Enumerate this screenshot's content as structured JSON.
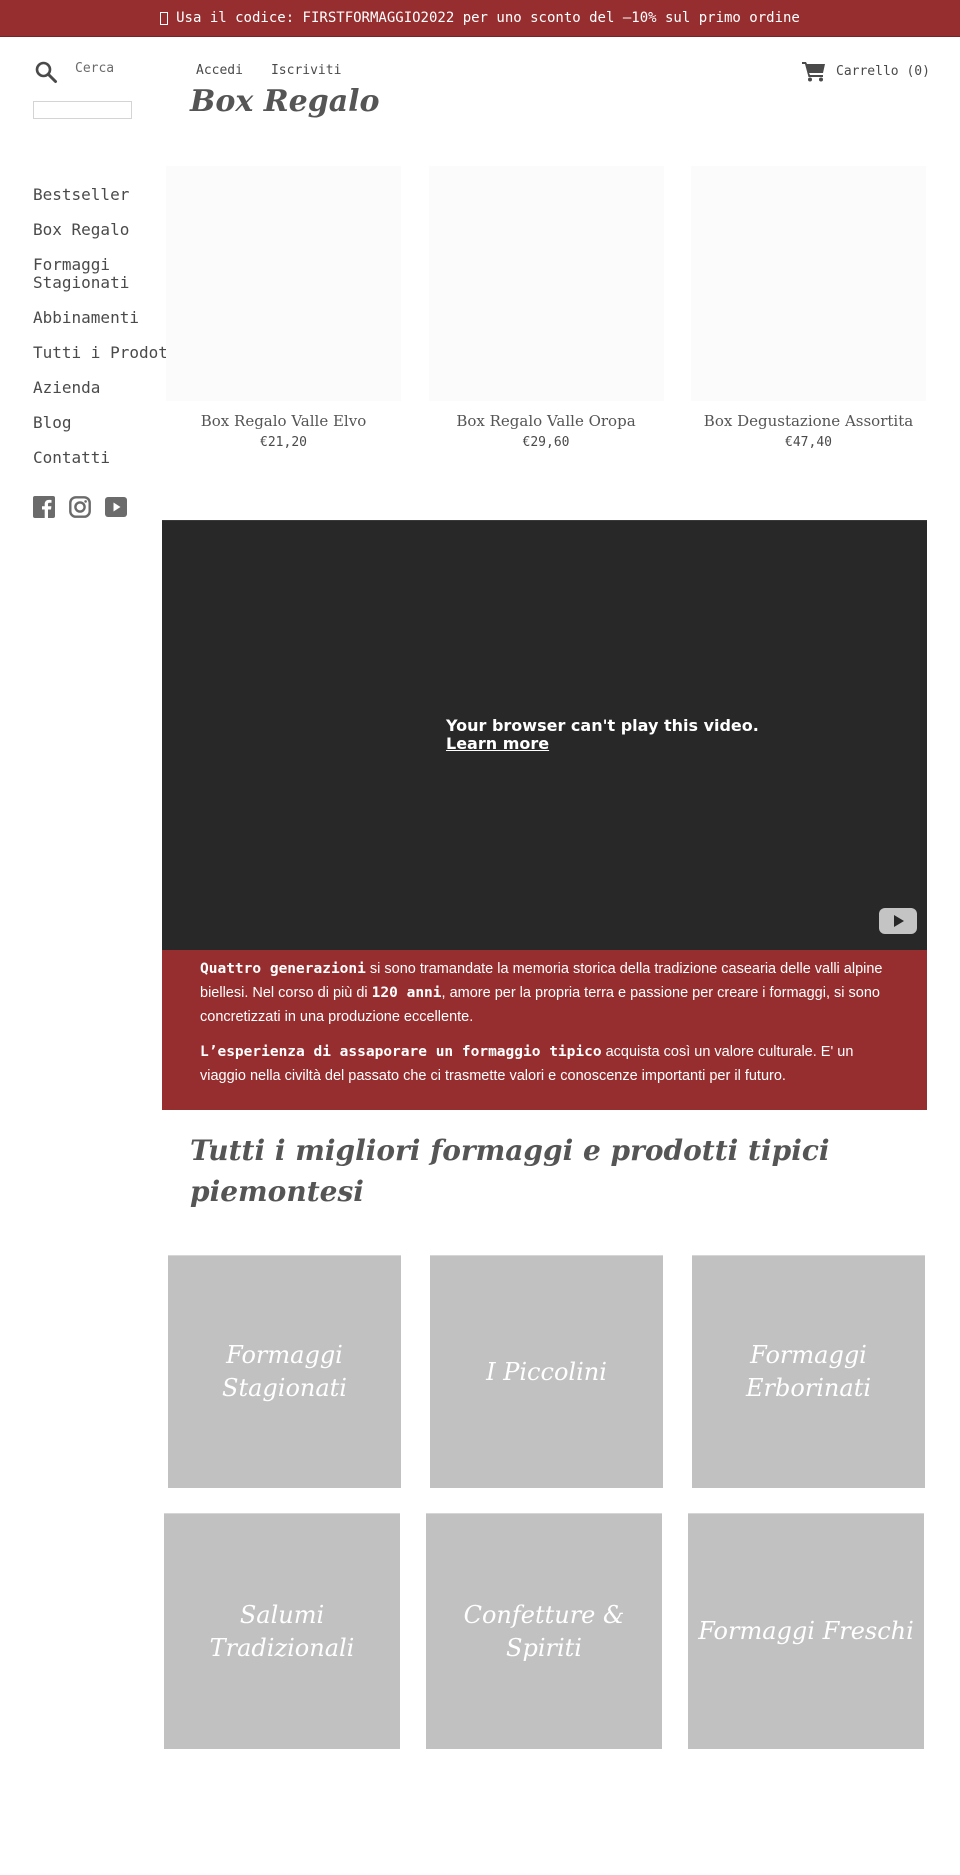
{
  "announcement": {
    "text": "Usa il codice: FIRSTFORMAGGIO2022 per uno sconto del —10% sul primo ordine"
  },
  "header": {
    "search_label": "Cerca",
    "search_placeholder": "",
    "account_links": [
      "Accedi",
      "Iscriviti"
    ],
    "cart_label": "Carrello (0)"
  },
  "page": {
    "title": "Box Regalo"
  },
  "sidebar": {
    "items": [
      {
        "label": "Bestseller"
      },
      {
        "label": "Box Regalo"
      },
      {
        "label": "Formaggi\nStagionati"
      },
      {
        "label": "Abbinamenti"
      },
      {
        "label": "Tutti i Prodotti"
      },
      {
        "label": "Azienda"
      },
      {
        "label": "Blog"
      },
      {
        "label": "Contatti"
      }
    ],
    "social": [
      "facebook-icon",
      "instagram-icon",
      "youtube-icon"
    ]
  },
  "products": [
    {
      "name": "Box Regalo Valle Elvo",
      "price": "€21,20"
    },
    {
      "name": "Box Regalo Valle Oropa",
      "price": "€29,60"
    },
    {
      "name": "Box Degustazione Assortita",
      "price": "€47,40"
    }
  ],
  "video": {
    "message": "Your browser can't play this video.",
    "learn_more": "Learn more"
  },
  "about": {
    "p1_bold1": "Quattro generazioni",
    "p1_text1": " si sono tramandate la memoria storica della tradizione casearia delle valli alpine biellesi. Nel corso di più di ",
    "p1_bold2": "120 anni",
    "p1_text2": ", amore per la propria terra e passione per creare i formaggi, si sono concretizzati in una produzione eccellente.",
    "p2_bold": "L’esperienza di assaporare un formaggio tipico",
    "p2_text": " acquista così un valore culturale. E' un viaggio nella civiltà del passato che ci trasmette valori e conoscenze importanti per il futuro."
  },
  "collections_section": {
    "title": "Tutti i migliori formaggi e prodotti tipici piemontesi",
    "items": [
      {
        "label": "Formaggi Stagionati"
      },
      {
        "label": "I Piccolini"
      },
      {
        "label": "Formaggi Erborinati"
      },
      {
        "label": "Salumi Tradizionali"
      },
      {
        "label": "Confetture & Spiriti"
      },
      {
        "label": "Formaggi Freschi"
      }
    ]
  },
  "colors": {
    "brand_red": "#962e2f",
    "collection_bg": "#c1c1c1",
    "video_bg": "#282828"
  }
}
